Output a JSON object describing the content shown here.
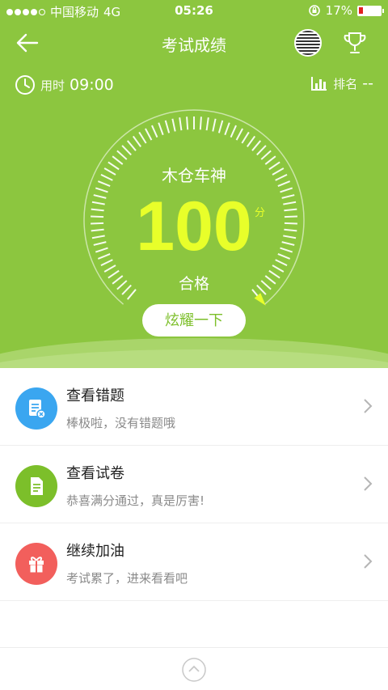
{
  "status_bar": {
    "carrier": "中国移动",
    "network": "4G",
    "time": "05:26",
    "battery": "17%"
  },
  "nav": {
    "title": "考试成绩",
    "icons": [
      "back-arrow-icon",
      "flag-avatar-icon",
      "trophy-icon"
    ]
  },
  "meta": {
    "time_label": "用时",
    "time_value": "09:00",
    "rank_label": "排名",
    "rank_value": "--"
  },
  "result": {
    "title": "木仓车神",
    "score": "100",
    "unit": "分",
    "status": "合格",
    "score_fraction": 1.0,
    "share_button": "炫耀一下"
  },
  "list": [
    {
      "title": "查看错题",
      "subtitle": "棒极啦，没有错题哦",
      "icon": "wrong-questions-icon",
      "color": "#3aa6f0"
    },
    {
      "title": "查看试卷",
      "subtitle": "恭喜满分通过，真是厉害!",
      "icon": "exam-paper-icon",
      "color": "#7cbf2a"
    },
    {
      "title": "继续加油",
      "subtitle": "考试累了，进来看看吧",
      "icon": "gift-icon",
      "color": "#f25f5c"
    }
  ],
  "colors": {
    "hero_green": "#8cc63f",
    "score_yellow": "#e8ff2a"
  }
}
